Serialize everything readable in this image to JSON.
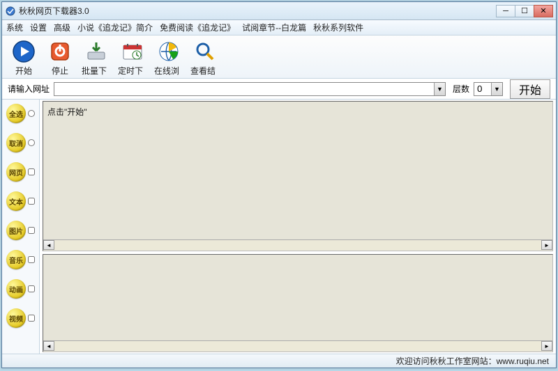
{
  "window": {
    "title": "秋秋网页下载器3.0"
  },
  "menu": {
    "items": [
      "系统",
      "设置",
      "高级",
      "小说《追龙记》简介",
      "免费阅读《追龙记》",
      "试阅章节--白龙篇",
      "秋秋系列软件"
    ]
  },
  "toolbar": {
    "start": "开始",
    "stop": "停止",
    "batch": "批量下载",
    "timed": "定时下载",
    "browse": "在线浏览",
    "result": "查看结果"
  },
  "urlRow": {
    "label": "请输入网址",
    "url_value": "",
    "layer_label": "层数",
    "layer_value": "0",
    "start_button": "开始"
  },
  "sidebar": {
    "items": [
      {
        "label": "全选"
      },
      {
        "label": "取消"
      },
      {
        "label": "网页"
      },
      {
        "label": "文本"
      },
      {
        "label": "图片"
      },
      {
        "label": "音乐"
      },
      {
        "label": "动画"
      },
      {
        "label": "视频"
      }
    ]
  },
  "topPane": {
    "hint": "点击\"开始\""
  },
  "status": {
    "text": "欢迎访问秋秋工作室网站：www.ruqiu.net"
  }
}
